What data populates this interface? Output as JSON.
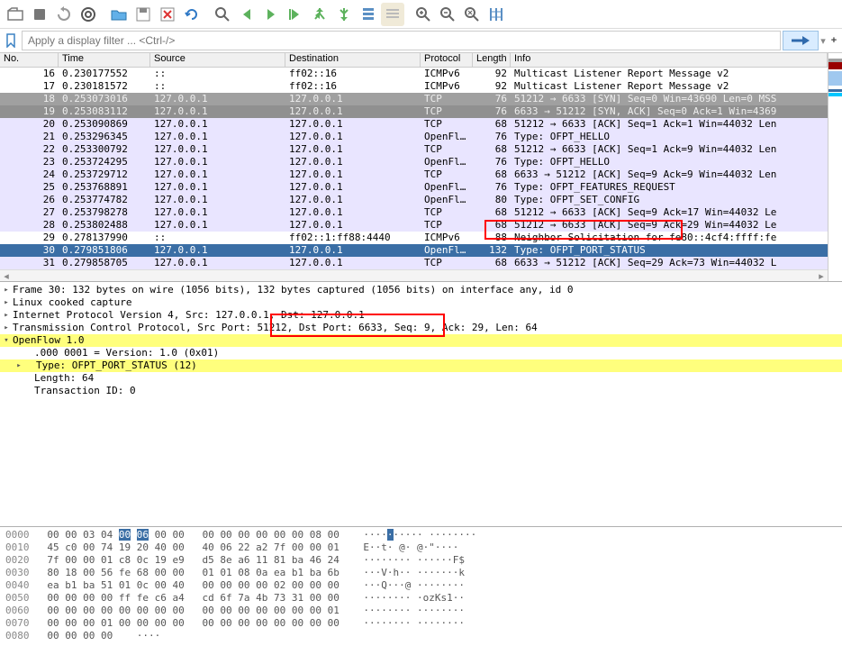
{
  "filter": {
    "placeholder": "Apply a display filter ... <Ctrl-/>"
  },
  "columns": {
    "no": "No.",
    "time": "Time",
    "src": "Source",
    "dst": "Destination",
    "proto": "Protocol",
    "len": "Length",
    "info": "Info"
  },
  "packets": [
    {
      "no": "16",
      "time": "0.230177552",
      "src": "::",
      "dst": "ff02::16",
      "proto": "ICMPv6",
      "len": "92",
      "info": "Multicast Listener Report Message v2",
      "cls": ""
    },
    {
      "no": "17",
      "time": "0.230181572",
      "src": "::",
      "dst": "ff02::16",
      "proto": "ICMPv6",
      "len": "92",
      "info": "Multicast Listener Report Message v2",
      "cls": ""
    },
    {
      "no": "18",
      "time": "0.253073016",
      "src": "127.0.0.1",
      "dst": "127.0.0.1",
      "proto": "TCP",
      "len": "76",
      "info": "51212 → 6633 [SYN] Seq=0 Win=43690 Len=0 MSS",
      "cls": "r-dark1"
    },
    {
      "no": "19",
      "time": "0.253083112",
      "src": "127.0.0.1",
      "dst": "127.0.0.1",
      "proto": "TCP",
      "len": "76",
      "info": "6633 → 51212 [SYN, ACK] Seq=0 Ack=1 Win=4369",
      "cls": "r-dark2"
    },
    {
      "no": "20",
      "time": "0.253090869",
      "src": "127.0.0.1",
      "dst": "127.0.0.1",
      "proto": "TCP",
      "len": "68",
      "info": "51212 → 6633 [ACK] Seq=1 Ack=1 Win=44032 Len",
      "cls": "r-lite"
    },
    {
      "no": "21",
      "time": "0.253296345",
      "src": "127.0.0.1",
      "dst": "127.0.0.1",
      "proto": "OpenFl…",
      "len": "76",
      "info": "Type: OFPT_HELLO",
      "cls": "r-lite"
    },
    {
      "no": "22",
      "time": "0.253300792",
      "src": "127.0.0.1",
      "dst": "127.0.0.1",
      "proto": "TCP",
      "len": "68",
      "info": "51212 → 6633 [ACK] Seq=1 Ack=9 Win=44032 Len",
      "cls": "r-lite"
    },
    {
      "no": "23",
      "time": "0.253724295",
      "src": "127.0.0.1",
      "dst": "127.0.0.1",
      "proto": "OpenFl…",
      "len": "76",
      "info": "Type: OFPT_HELLO",
      "cls": "r-lite"
    },
    {
      "no": "24",
      "time": "0.253729712",
      "src": "127.0.0.1",
      "dst": "127.0.0.1",
      "proto": "TCP",
      "len": "68",
      "info": "6633 → 51212 [ACK] Seq=9 Ack=9 Win=44032 Len",
      "cls": "r-lite"
    },
    {
      "no": "25",
      "time": "0.253768891",
      "src": "127.0.0.1",
      "dst": "127.0.0.1",
      "proto": "OpenFl…",
      "len": "76",
      "info": "Type: OFPT_FEATURES_REQUEST",
      "cls": "r-lite"
    },
    {
      "no": "26",
      "time": "0.253774782",
      "src": "127.0.0.1",
      "dst": "127.0.0.1",
      "proto": "OpenFl…",
      "len": "80",
      "info": "Type: OFPT_SET_CONFIG",
      "cls": "r-lite"
    },
    {
      "no": "27",
      "time": "0.253798278",
      "src": "127.0.0.1",
      "dst": "127.0.0.1",
      "proto": "TCP",
      "len": "68",
      "info": "51212 → 6633 [ACK] Seq=9 Ack=17 Win=44032 Le",
      "cls": "r-lite"
    },
    {
      "no": "28",
      "time": "0.253802488",
      "src": "127.0.0.1",
      "dst": "127.0.0.1",
      "proto": "TCP",
      "len": "68",
      "info": "51212 → 6633 [ACK] Seq=9 Ack=29 Win=44032 Le",
      "cls": "r-lite"
    },
    {
      "no": "29",
      "time": "0.278137990",
      "src": "::",
      "dst": "ff02::1:ff88:4440",
      "proto": "ICMPv6",
      "len": "88",
      "info": "Neighbor Solicitation for fe80::4cf4:ffff:fe",
      "cls": ""
    },
    {
      "no": "30",
      "time": "0.279851806",
      "src": "127.0.0.1",
      "dst": "127.0.0.1",
      "proto": "OpenFl…",
      "len": "132",
      "info": "Type: OFPT_PORT_STATUS",
      "cls": "r-sel"
    },
    {
      "no": "31",
      "time": "0.279858705",
      "src": "127.0.0.1",
      "dst": "127.0.0.1",
      "proto": "TCP",
      "len": "68",
      "info": "6633 → 51212 [ACK] Seq=29 Ack=73 Win=44032 L",
      "cls": "r-lite"
    }
  ],
  "details": {
    "frame": "Frame 30: 132 bytes on wire (1056 bits), 132 bytes captured (1056 bits) on interface any, id 0",
    "linux": "Linux cooked capture",
    "ip": "Internet Protocol Version 4, Src: 127.0.0.1, Dst: 127.0.0.1",
    "tcp": "Transmission Control Protocol, Src Port: 51212, Dst Port: 6633, Seq: 9, Ack: 29, Len: 64",
    "of": "OpenFlow 1.0",
    "ver": ".000 0001 = Version: 1.0 (0x01)",
    "type": "Type: OFPT_PORT_STATUS (12)",
    "length": "Length: 64",
    "tid": "Transaction ID: 0"
  },
  "hex": [
    {
      "off": "0000",
      "b": "00 00 03 04 00 06 00 00  00 00 00 00 00 00 08 00",
      "a": "····",
      "sel": [
        4,
        5
      ],
      "asel": 4,
      "a2": "····· ········"
    },
    {
      "off": "0010",
      "b": "45 c0 00 74 19 20 40 00  40 06 22 a2 7f 00 00 01",
      "a": "E··t· @· @·\"····"
    },
    {
      "off": "0020",
      "b": "7f 00 00 01 c8 0c 19 e9  d5 8e a6 11 81 ba 46 24",
      "a": "········ ······F$"
    },
    {
      "off": "0030",
      "b": "80 18 00 56 fe 68 00 00  01 01 08 0a ea b1 ba 6b",
      "a": "···V·h·· ·······k"
    },
    {
      "off": "0040",
      "b": "ea b1 ba 51 01 0c 00 40  00 00 00 00 02 00 00 00",
      "a": "···Q···@ ········"
    },
    {
      "off": "0050",
      "b": "00 00 00 00 ff fe c6 a4  cd 6f 7a 4b 73 31 00 00",
      "a": "········ ·ozKs1··"
    },
    {
      "off": "0060",
      "b": "00 00 00 00 00 00 00 00  00 00 00 00 00 00 00 01",
      "a": "········ ········"
    },
    {
      "off": "0070",
      "b": "00 00 00 01 00 00 00 00  00 00 00 00 00 00 00 00",
      "a": "········ ········"
    },
    {
      "off": "0080",
      "b": "00 00 00 00",
      "a": "····"
    }
  ]
}
